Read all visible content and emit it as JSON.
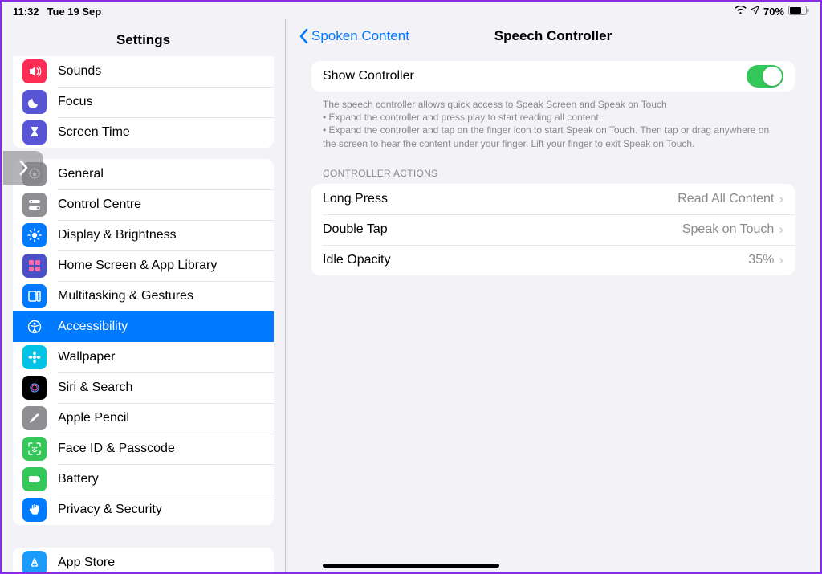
{
  "status": {
    "time": "11:32",
    "date": "Tue 19 Sep",
    "battery_pct": "70%"
  },
  "sidebar": {
    "title": "Settings",
    "group_top": [
      {
        "label": "Sounds",
        "icon": "speaker",
        "color": "#ff2d55"
      },
      {
        "label": "Focus",
        "icon": "moon",
        "color": "#5856d6"
      },
      {
        "label": "Screen Time",
        "icon": "hourglass",
        "color": "#5856d6"
      }
    ],
    "group_mid": [
      {
        "label": "General",
        "icon": "gear",
        "color": "#8e8e93"
      },
      {
        "label": "Control Centre",
        "icon": "switches",
        "color": "#8e8e93"
      },
      {
        "label": "Display & Brightness",
        "icon": "brightness",
        "color": "#007aff"
      },
      {
        "label": "Home Screen & App Library",
        "icon": "grid",
        "color": "#4b50c7"
      },
      {
        "label": "Multitasking & Gestures",
        "icon": "multitask",
        "color": "#007aff"
      },
      {
        "label": "Accessibility",
        "icon": "accessibility",
        "color": "#007aff",
        "selected": true
      },
      {
        "label": "Wallpaper",
        "icon": "flower",
        "color": "#00c3e6"
      },
      {
        "label": "Siri & Search",
        "icon": "siri",
        "color": "#000000"
      },
      {
        "label": "Apple Pencil",
        "icon": "pencil",
        "color": "#8e8e93"
      },
      {
        "label": "Face ID & Passcode",
        "icon": "faceid",
        "color": "#34c759"
      },
      {
        "label": "Battery",
        "icon": "battery",
        "color": "#34c759"
      },
      {
        "label": "Privacy & Security",
        "icon": "hand",
        "color": "#007aff"
      }
    ],
    "group_bottom": [
      {
        "label": "App Store",
        "icon": "appstore",
        "color": "#1a9cff"
      }
    ]
  },
  "detail": {
    "back_label": "Spoken Content",
    "title": "Speech Controller",
    "show_controller": {
      "label": "Show Controller",
      "on": true
    },
    "explanation_line1": "The speech controller allows quick access to Speak Screen and Speak on Touch",
    "explanation_line2": " • Expand the controller and press play to start reading all content.",
    "explanation_line3": " • Expand the controller and tap on the finger icon to start Speak on Touch. Then tap or drag anywhere on the screen to hear the content under your finger. Lift your finger to exit Speak on Touch.",
    "actions_header": "CONTROLLER ACTIONS",
    "actions": [
      {
        "label": "Long Press",
        "value": "Read All Content"
      },
      {
        "label": "Double Tap",
        "value": "Speak on Touch"
      },
      {
        "label": "Idle Opacity",
        "value": "35%"
      }
    ]
  }
}
